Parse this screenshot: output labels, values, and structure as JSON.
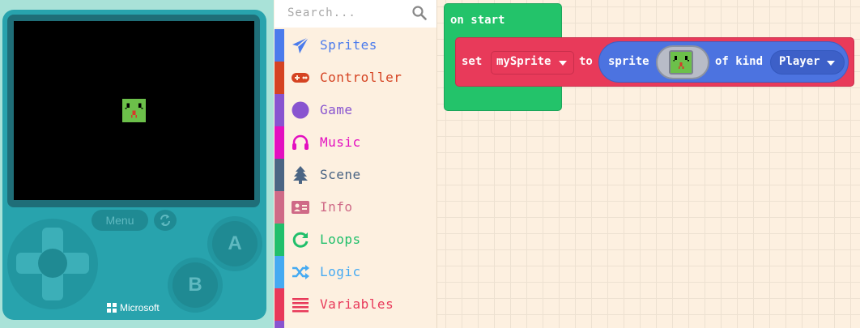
{
  "simulator": {
    "menu_label": "Menu",
    "button_a": "A",
    "button_b": "B",
    "brand": "Microsoft"
  },
  "toolbox": {
    "search_placeholder": "Search...",
    "categories": [
      {
        "label": "Sprites",
        "color": "#4b7bec",
        "icon": "paper-plane-icon"
      },
      {
        "label": "Controller",
        "color": "#d54322",
        "icon": "gamepad-icon"
      },
      {
        "label": "Game",
        "color": "#8854d0",
        "icon": "circle-icon"
      },
      {
        "label": "Music",
        "color": "#e30fc0",
        "icon": "headphones-icon"
      },
      {
        "label": "Scene",
        "color": "#4b6584",
        "icon": "tree-icon"
      },
      {
        "label": "Info",
        "color": "#cf6a87",
        "icon": "id-card-icon"
      },
      {
        "label": "Loops",
        "color": "#20bf6b",
        "icon": "refresh-icon"
      },
      {
        "label": "Logic",
        "color": "#45aaf2",
        "icon": "shuffle-icon"
      },
      {
        "label": "Variables",
        "color": "#e8395a",
        "icon": "list-icon"
      }
    ]
  },
  "workspace": {
    "event_label": "on start",
    "set_label": "set",
    "variable_name": "mySprite",
    "to_label": "to",
    "sprite_label": "sprite",
    "of_kind_label": "of kind",
    "kind_value": "Player"
  },
  "colors": {
    "events": "#23c36a",
    "variables": "#e83a5a",
    "sprites": "#4c73e0",
    "console": "#28a3ad"
  }
}
